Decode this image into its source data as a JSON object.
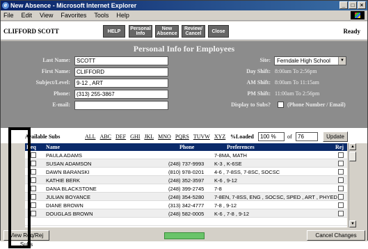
{
  "window": {
    "title": "New Absence - Microsoft Internet Explorer",
    "controls": [
      "minimize-icon",
      "maximize-icon",
      "close-icon"
    ]
  },
  "menu": [
    "File",
    "Edit",
    "View",
    "Favorites",
    "Tools",
    "Help"
  ],
  "toolbar": {
    "user": "CLIFFORD SCOTT",
    "help": "HELP",
    "personal_info": "Personal Info",
    "new_absence": "New Absence",
    "review_cancel": "Review/ Cancel",
    "close": "Close",
    "status": "Ready"
  },
  "personal": {
    "title": "Personal Info for Employees",
    "last_name_label": "Last Name:",
    "last_name": "SCOTT",
    "first_name_label": "First Name:",
    "first_name": "CLIFFORD",
    "subject_label": "Subject/Level:",
    "subject": "9-12 , ART",
    "phone_label": "Phone:",
    "phone": "(313) 255-3867",
    "email_label": "E-mail:",
    "email": "",
    "site_label": "Site:",
    "site": "Ferndale High School",
    "day_shift_label": "Day Shift:",
    "day_shift": "8:00am To 2:56pm",
    "am_shift_label": "AM Shift:",
    "am_shift": "8:00am To 11:15am",
    "pm_shift_label": "PM Shift:",
    "pm_shift": "11:00am To 2:56pm",
    "display_label": "Display to Subs?",
    "display_note": "(Phone Number / Email)"
  },
  "filter": {
    "available_label": "Available Subs",
    "letters": [
      "ALL",
      "ABC",
      "DEF",
      "GHI",
      "JKL",
      "MNO",
      "PQRS",
      "TUVW",
      "XYZ"
    ],
    "loaded_label": "%Loaded",
    "loaded_value": "100 %",
    "of_label": "of",
    "total": "76",
    "update": "Update"
  },
  "table": {
    "headers": [
      "Req",
      "Name",
      "Phone",
      "Preferences",
      "Rej"
    ],
    "rows": [
      {
        "name": "PAULA ADAMS",
        "phone": "",
        "prefs": "7-8MA, MATH"
      },
      {
        "name": "SUSAN ADAMSON",
        "phone": "(248) 737-9993",
        "prefs": "K-3 , K-6SE"
      },
      {
        "name": "DAWN BARANSKI",
        "phone": "(810) 978-0201",
        "prefs": "4-6 , 7-8SS, 7-8SC, SOCSC"
      },
      {
        "name": "KATHIE BERK",
        "phone": "(248) 352-3597",
        "prefs": "K-6 , 9-12"
      },
      {
        "name": "DANA BLACKSTONE",
        "phone": "(248) 399-2745",
        "prefs": "7-8"
      },
      {
        "name": "JULIAN BOYANCE",
        "phone": "(248) 354-5280",
        "prefs": "7-8EN, 7-8SS, ENG , SOCSC, SPED , ART , PHYED"
      },
      {
        "name": "DIANE BROWN",
        "phone": "(313) 342-4777",
        "prefs": "7-8 , 9-12"
      },
      {
        "name": "DOUGLAS BROWN",
        "phone": "(248) 582-0005",
        "prefs": "K-6 , 7-8 , 9-12"
      },
      {
        "name": "",
        "phone": "",
        "prefs": ""
      }
    ]
  },
  "bottom": {
    "view_req_rej": "View Req/Rej Subs",
    "cancel_changes": "Cancel Changes"
  }
}
